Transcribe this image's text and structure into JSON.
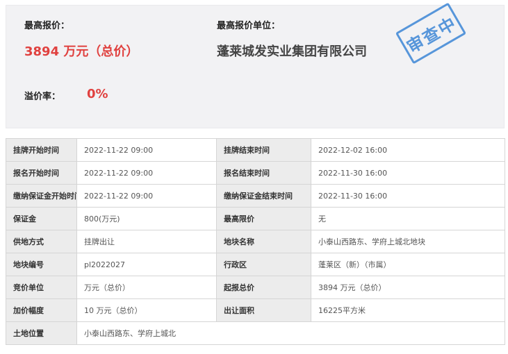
{
  "summary": {
    "highest_bid_label": "最高报价：",
    "highest_bid_value": "3894 万元（总价）",
    "highest_bidder_label": "最高报价单位：",
    "highest_bidder_value": "蓬莱城发实业集团有限公司",
    "premium_rate_label": "溢价率：",
    "premium_rate_value": "0%",
    "stamp_text": "审查中"
  },
  "rows": [
    {
      "k1": "挂牌开始时间",
      "v1": "2022-11-22 09:00",
      "k2": "挂牌结束时间",
      "v2": "2022-12-02 16:00"
    },
    {
      "k1": "报名开始时间",
      "v1": "2022-11-22 09:00",
      "k2": "报名结束时间",
      "v2": "2022-11-30 16:00"
    },
    {
      "k1": "缴纳保证金开始时间",
      "v1": "2022-11-22 09:00",
      "k2": "缴纳保证金结束时间",
      "v2": "2022-11-30 16:00"
    },
    {
      "k1": "保证金",
      "v1": "800(万元)",
      "k2": "最高限价",
      "v2": "无"
    },
    {
      "k1": "供地方式",
      "v1": "挂牌出让",
      "k2": "地块名称",
      "v2": "小泰山西路东、学府上城北地块"
    },
    {
      "k1": "地块编号",
      "v1": "pl2022027",
      "k2": "行政区",
      "v2": "蓬莱区（新）（市属）"
    },
    {
      "k1": "竞价单位",
      "v1": "万元（总价）",
      "k2": "起报总价",
      "v2": "3894 万元（总价）"
    },
    {
      "k1": "加价幅度",
      "v1": "10 万元（总价）",
      "k2": "出让面积",
      "v2": "16225平方米"
    }
  ],
  "location_row": {
    "k": "土地位置",
    "v": "小泰山西路东、学府上城北"
  },
  "colors": {
    "accent_red": "#e0413f",
    "stamp_blue": "#3d86d6"
  }
}
